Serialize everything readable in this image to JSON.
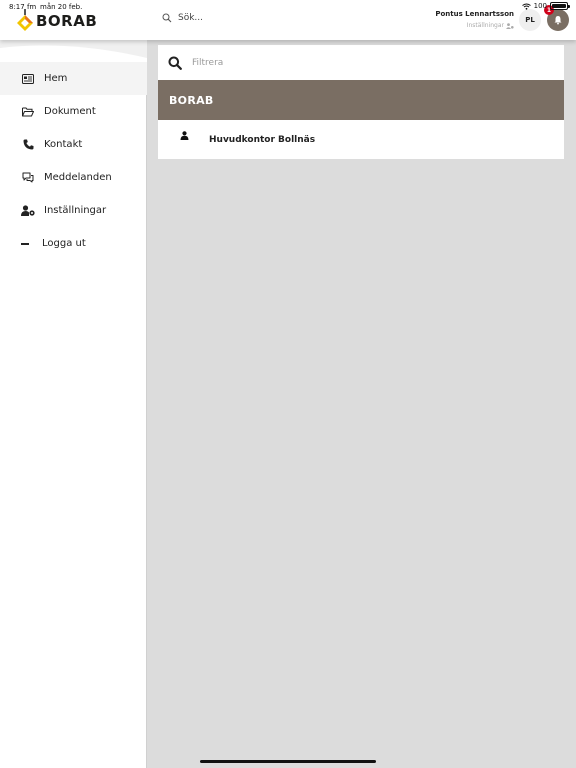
{
  "status_bar": {
    "time": "8:17 fm",
    "date": "mån 20 feb.",
    "battery": "100"
  },
  "header": {
    "logo_text": "BORAB",
    "search_placeholder": "Sök...",
    "user_name": "Pontus Lennartsson",
    "user_settings_label": "Inställningar",
    "avatar_initials": "PL",
    "notification_count": "1"
  },
  "sidebar": {
    "items": [
      {
        "label": "Hem",
        "icon": "newspaper-icon",
        "active": true
      },
      {
        "label": "Dokument",
        "icon": "folder-open-icon"
      },
      {
        "label": "Kontakt",
        "icon": "phone-icon"
      },
      {
        "label": "Meddelanden",
        "icon": "chat-icon"
      },
      {
        "label": "Inställningar",
        "icon": "user-cog-icon"
      },
      {
        "label": "Logga ut",
        "icon": "minus-icon"
      }
    ]
  },
  "main": {
    "filter_placeholder": "Filtrera",
    "group_title": "BORAB",
    "rows": [
      {
        "label": "Huvudkontor Bollnäs",
        "icon": "person-icon"
      }
    ]
  },
  "colors": {
    "accent": "#7a6e63",
    "badge": "#d0021b",
    "logo_yellow": "#f2c500",
    "logo_orange": "#e8731c"
  }
}
